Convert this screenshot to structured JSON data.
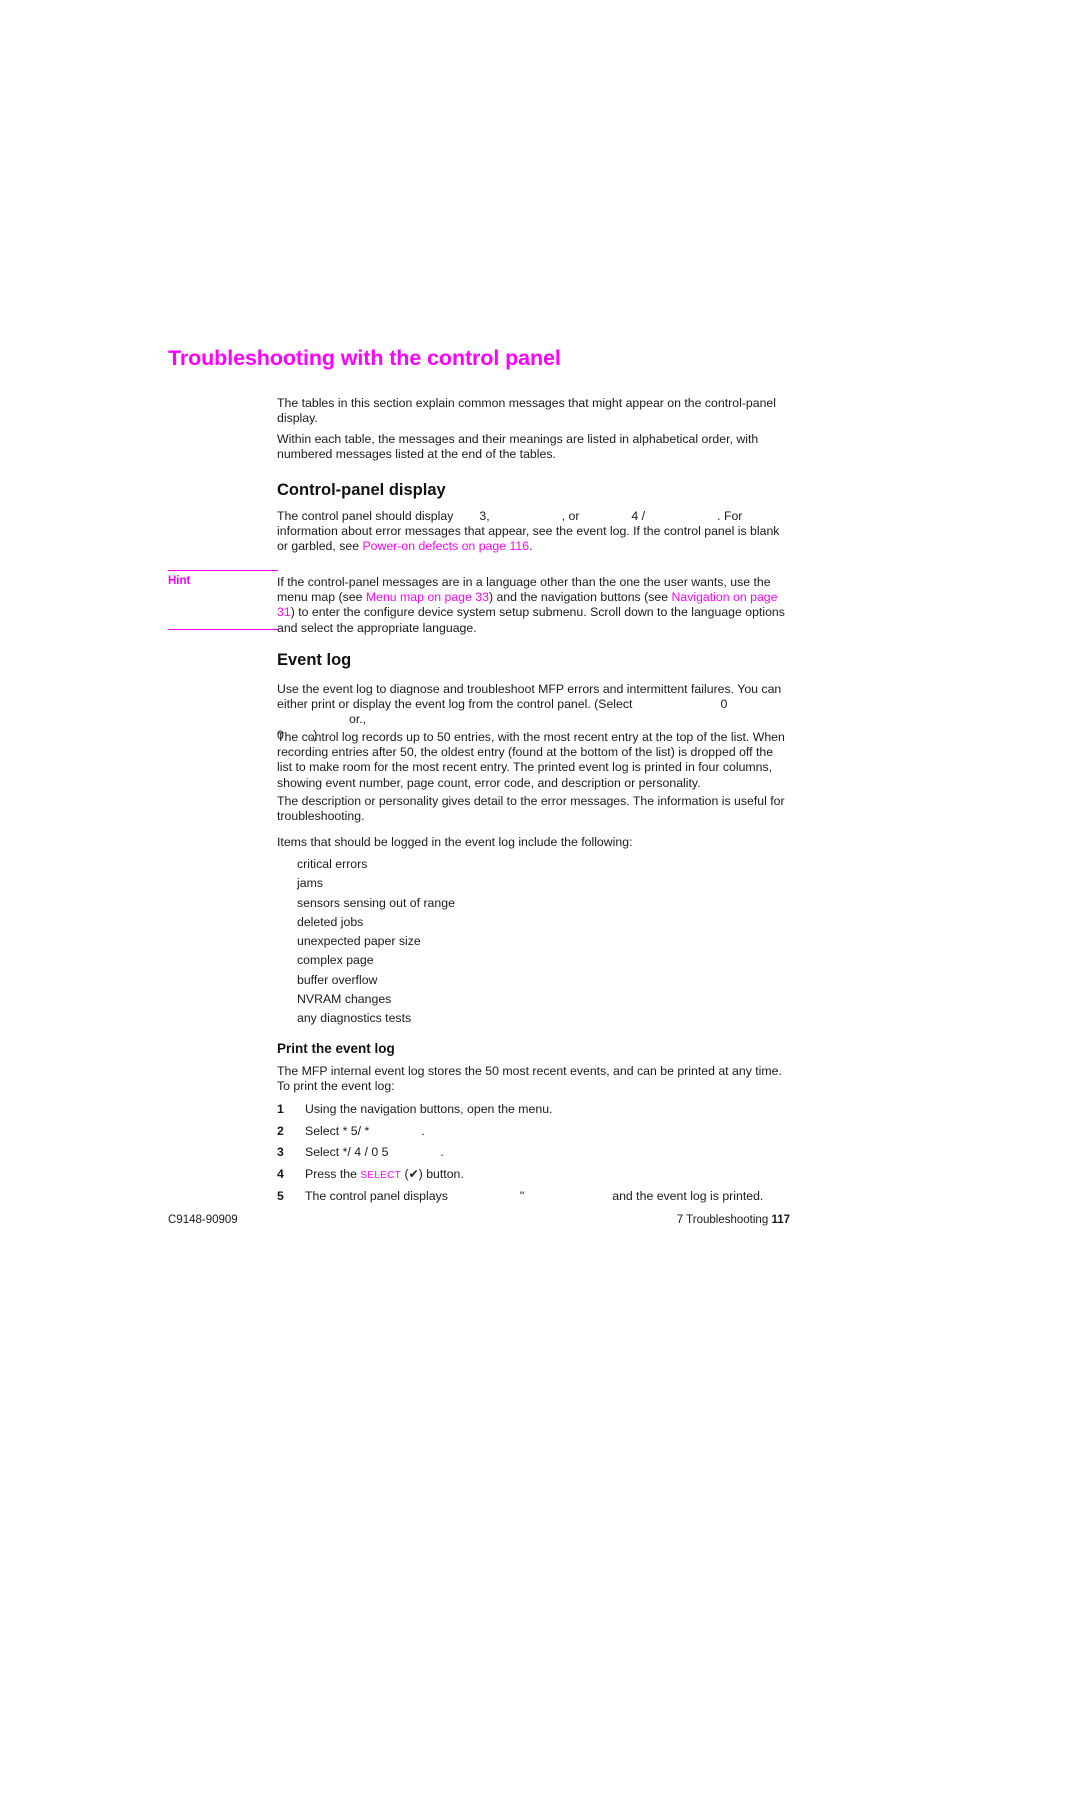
{
  "document": {
    "part_number": "C9148-90909",
    "footer_chapter": "7 Troubleshooting",
    "page_number": "117"
  },
  "title": "Troubleshooting with the control panel",
  "intro": {
    "para1": "The tables in this section explain common messages that might appear on the control-panel display.",
    "para2": "Within each table, the messages and their meanings are listed in alphabetical order, with numbered messages listed at the end of the tables."
  },
  "control_panel_display": {
    "heading": "Control-panel display",
    "para_part1": "The control panel should display",
    "para_msg1": "3",
    "para_comma": ",",
    "para_or": ", or",
    "para_msg2": "4 /",
    "para_part2": ". For information about error messages that appear, see the event log. If the control panel is blank or garbled, see",
    "xref_poweron": "Power-on defects",
    "xref_poweron_page": "on page 116",
    "para_period": "."
  },
  "hint": {
    "label": "Hint",
    "text_part1": "If the control-panel messages are in a language other than the one the user wants, use the menu map (see",
    "xref_menu_map": "Menu map",
    "xref_menu_map_page": "on page 33",
    "text_part2": ") and the navigation buttons (see",
    "xref_navigation": "Navigation",
    "xref_navigation_page": "on page 31",
    "text_part3": ") to enter the configure device system setup submenu. Scroll down to the language options and select the appropriate language."
  },
  "event_log": {
    "heading": "Event log",
    "para1_part1": "Use the event log to diagnose and troubleshoot MFP errors and intermittent failures. You can either print or display the event log from the control panel. (Select",
    "para1_msg1": "0",
    "para1_or": "or",
    "para1_comma": ".,",
    "para1_msg2": "0",
    "para1_end": ".)",
    "para2": "The control log records up to 50 entries, with the most recent entry at the top of the list. When recording entries after 50, the oldest entry (found at the bottom of the list) is dropped off the list to make room for the most recent entry. The printed event log is printed in four columns, showing event number, page count, error code, and description or personality.",
    "para3": "The description or personality gives detail to the error messages. The information is useful for troubleshooting.",
    "para4": "Items that should be logged in the event log include the following:",
    "bullets": [
      "critical errors",
      "jams",
      "sensors sensing out of range",
      "deleted jobs",
      "unexpected paper size",
      "complex page",
      "buffer overflow",
      "NVRAM changes",
      "any diagnostics tests"
    ]
  },
  "print_event_log": {
    "heading": "Print the event log",
    "intro": "The MFP internal event log stores the 50 most recent events, and can be printed at any time. To print the event log:",
    "steps": [
      {
        "num": "1",
        "text": "Using the navigation buttons, open the menu."
      },
      {
        "num": "2",
        "text_pre": "Select",
        "code": "* 5/ *",
        "text_post": "."
      },
      {
        "num": "3",
        "text_pre": "Select",
        "code": "*/ 4 / 0 5",
        "text_post": "."
      },
      {
        "num": "4",
        "text_pre": "Press the",
        "smallcaps": "SELECT",
        "paren_open": "(",
        "glyph": "✔",
        "paren_close": ")",
        "text_post": "button."
      },
      {
        "num": "5",
        "text_pre": "The control panel displays",
        "code": "\"",
        "text_post": "and the event log is printed."
      }
    ]
  },
  "colors": {
    "accent": "#ff00ff",
    "text": "#1a1a1a"
  }
}
